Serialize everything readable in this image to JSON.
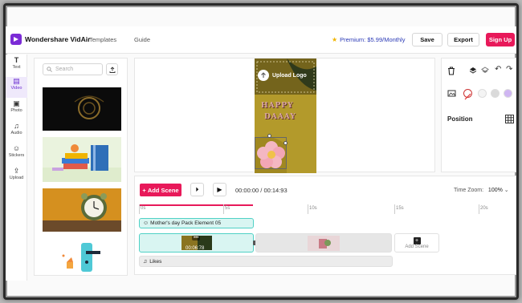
{
  "app": {
    "name": "Wondershare VidAir"
  },
  "nav": {
    "templates": "Templates",
    "guide": "Guide"
  },
  "header": {
    "premium": "Premium: $5.99/Monthly",
    "save": "Save",
    "export": "Export",
    "signup": "Sign Up"
  },
  "tools": [
    {
      "label": "Text",
      "icon": "text-icon"
    },
    {
      "label": "Video",
      "icon": "video-icon",
      "active": true
    },
    {
      "label": "Photo",
      "icon": "photo-icon"
    },
    {
      "label": "Audio",
      "icon": "audio-icon"
    },
    {
      "label": "Stickers",
      "icon": "stickers-icon"
    },
    {
      "label": "Upload",
      "icon": "upload-icon"
    }
  ],
  "media": {
    "search_placeholder": "Search"
  },
  "preview": {
    "upload_logo": "Upload Logo",
    "text_line1": "HAPPY",
    "text_line2": "DAAAY"
  },
  "props": {
    "position_label": "Position"
  },
  "timeline": {
    "add_scene": "Add Scene",
    "time": "00:00:00 / 00:14:93",
    "zoom_label": "Time Zoom:",
    "zoom_value": "100%",
    "ruler": [
      "0s",
      "5s",
      "10s",
      "15s",
      "20s"
    ],
    "element_track": "Mother's day Pack Element 05",
    "clip_duration": "00:06:78",
    "add_scene_slot": "Add Scene",
    "audio_track": "Likes"
  },
  "colors": {
    "accent": "#e8195a",
    "brand": "#7b2bd6",
    "selected": "#4fd1c5"
  }
}
